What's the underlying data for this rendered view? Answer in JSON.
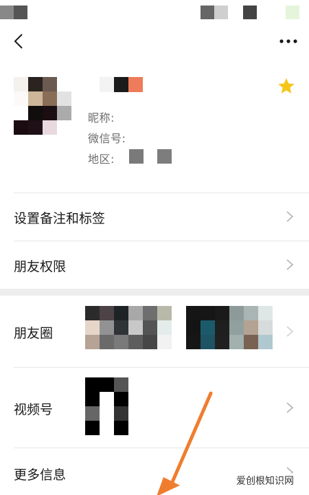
{
  "status_bar": {},
  "nav": {
    "back_icon": "chevron-left-icon",
    "more_icon": "more-dots-icon"
  },
  "profile": {
    "nickname_label": "昵称:",
    "wechat_id_label": "微信号:",
    "region_label": "地区:",
    "star_icon": "star-icon",
    "star_color": "#f5c518"
  },
  "rows": {
    "remark_tags": "设置备注和标签",
    "friend_permissions": "朋友权限",
    "moments": "朋友圈",
    "channels": "视频号",
    "more_info": "更多信息"
  },
  "watermark": "爱创根知识网",
  "colors": {
    "accent_arrow": "#f07d2e",
    "divider": "#e6e6e6",
    "section_gap": "#ededed"
  }
}
